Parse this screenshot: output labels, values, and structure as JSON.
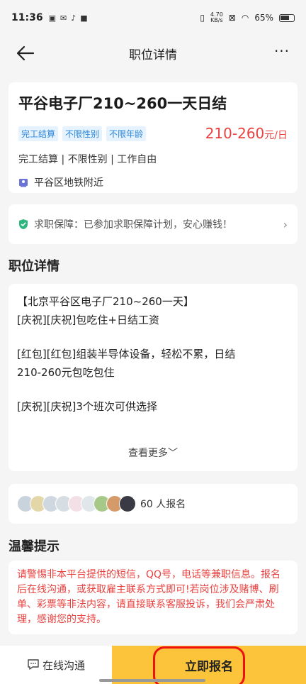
{
  "status": {
    "time": "11:36",
    "net_speed_value": "4.70",
    "net_speed_unit": "KB/s",
    "battery": "65%"
  },
  "nav": {
    "title": "职位详情",
    "back_icon": "arrow-left-icon",
    "more_icon": "more-dots-icon",
    "more_glyph": "···"
  },
  "job": {
    "title": "平谷电子厂210~260一天日结",
    "tags": [
      "完工结算",
      "不限性别",
      "不限年龄"
    ],
    "salary_value": "210-260",
    "salary_unit": "元/日",
    "description": "完工结算 | 不限性别 | 工作自由",
    "location": "平谷区地铁附近"
  },
  "guarantee": {
    "text": "求职保障：已参加求职保障计划，安心赚钱！",
    "arrow": "›"
  },
  "details": {
    "section_title": "职位详情",
    "lines": [
      "【北京平谷区电子厂210~260一天】",
      "[庆祝][庆祝]包吃住+日结工资",
      "",
      "[红包][红包]组装半导体设备，轻松不累，日结",
      "210-260元包吃包住",
      "",
      "[庆祝][庆祝]3个班次可供选择"
    ],
    "see_more": "查看更多﹀"
  },
  "applicants": {
    "count_label": "60 人报名",
    "avatar_colors": [
      "#c9d3dc",
      "#e3d6a8",
      "#cfd8e0",
      "#d6dde3",
      "#f3e0e6",
      "#dfe7ea",
      "#a6c98a",
      "#d49a6a",
      "#3a3a44"
    ]
  },
  "tips": {
    "section_title": "温馨提示",
    "text": "请警惕非本平台提供的短信，QQ号，电话等兼职信息。报名后在线沟通，或获取雇主联系方式即可!若岗位涉及赌博、刷单、彩票等非法内容，请直接联系客服投诉，我们会严肃处理，感谢您的支持。"
  },
  "bottom": {
    "chat_label": "在线沟通",
    "apply_label": "立即报名"
  },
  "colors": {
    "accent_red": "#e8413f",
    "tag_blue": "#2a86d8",
    "apply_yellow": "#fcc43a",
    "guarantee_green": "#2cb67d"
  }
}
